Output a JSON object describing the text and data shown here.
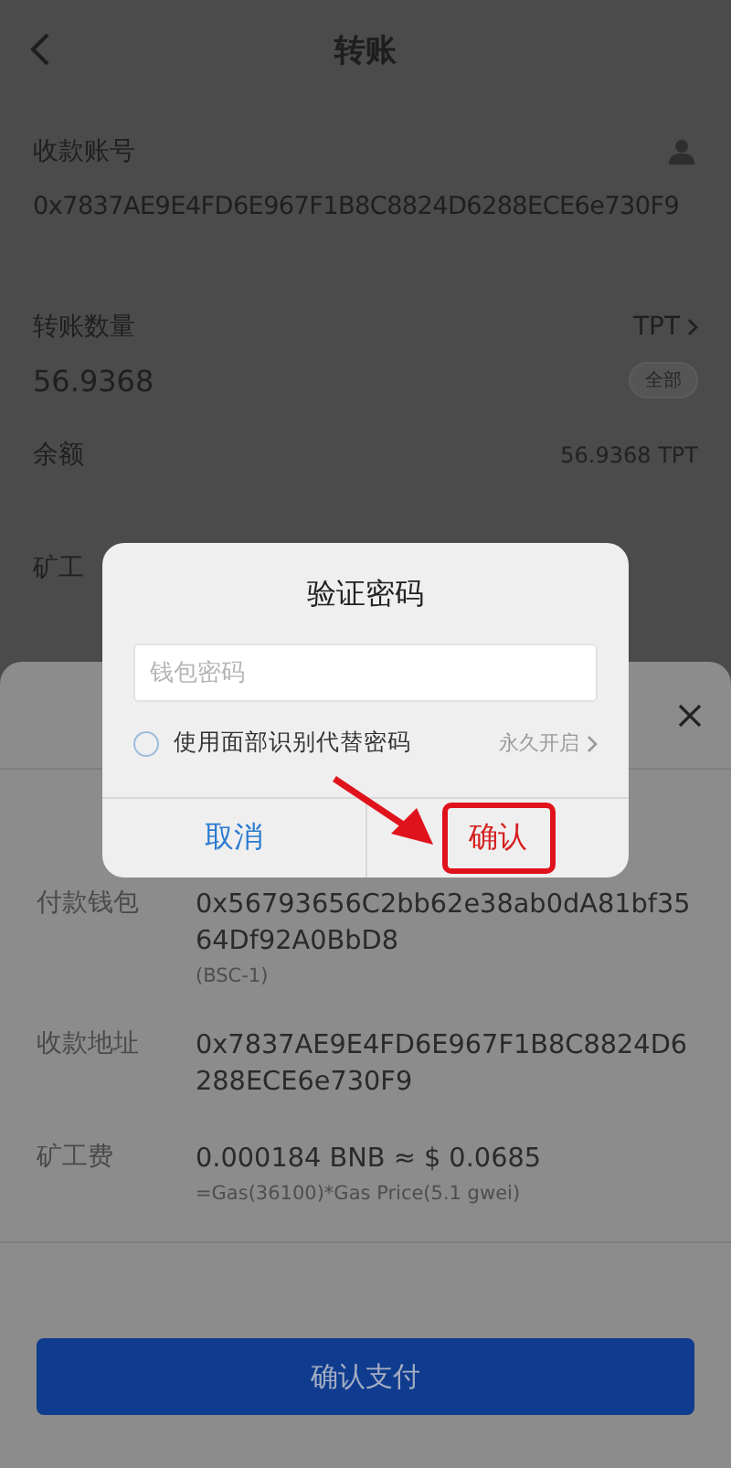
{
  "header": {
    "title": "转账"
  },
  "recipient": {
    "label": "收款账号",
    "address": "0x7837AE9E4FD6E967F1B8C8824D6288ECE6e730F9"
  },
  "amount": {
    "label": "转账数量",
    "token": "TPT",
    "value": "56.9368",
    "all_button": "全部"
  },
  "balance": {
    "label": "余额",
    "value": "56.9368 TPT"
  },
  "fee_label": "矿工",
  "sheet": {
    "rows": [
      {
        "label": "付款钱包",
        "value": "0x56793656C2bb62e38ab0dA81bf3564Df92A0BbD8",
        "note": "(BSC-1)"
      },
      {
        "label": "收款地址",
        "value": "0x7837AE9E4FD6E967F1B8C8824D6288ECE6e730F9"
      },
      {
        "label": "矿工费",
        "value": "0.000184 BNB ≈ $ 0.0685",
        "note": "=Gas(36100)*Gas Price(5.1 gwei)"
      }
    ],
    "button": "确认支付"
  },
  "dialog": {
    "title": "验证密码",
    "password": {
      "placeholder": "钱包密码"
    },
    "face_id": {
      "label": "使用面部识别代替密码",
      "checked": false,
      "link": "永久开启"
    },
    "buttons": [
      {
        "label": "取消",
        "kind": "cancel",
        "highlighted": false
      },
      {
        "label": "确认",
        "kind": "confirm",
        "highlighted": true
      }
    ]
  }
}
